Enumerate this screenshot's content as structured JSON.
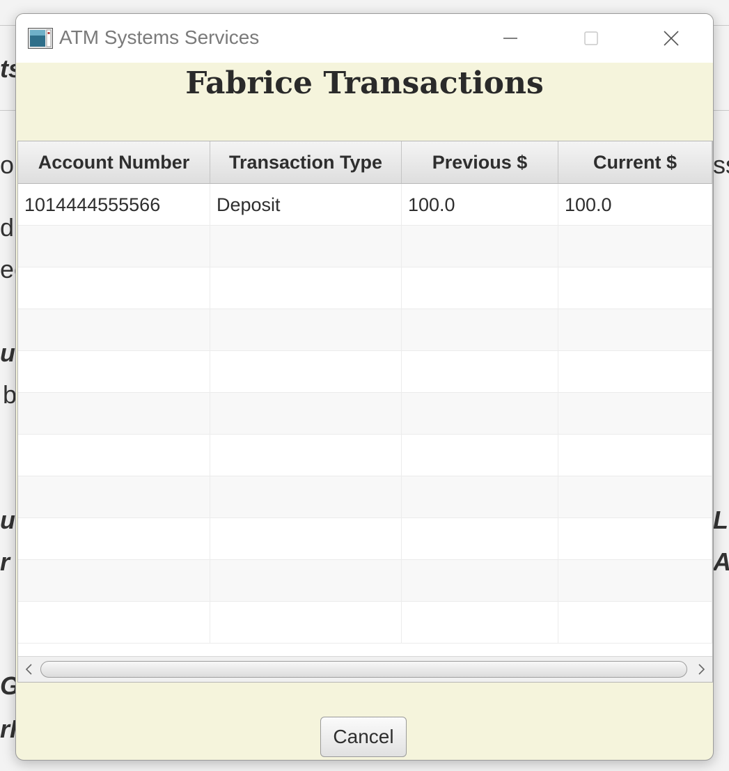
{
  "window": {
    "title": "ATM Systems Services",
    "controls": [
      "minimize",
      "maximize",
      "close"
    ]
  },
  "heading": "Fabrice Transactions",
  "table": {
    "columns": [
      "Account Number",
      "Transaction Type",
      "Previous $",
      "Current $"
    ],
    "rows": [
      [
        "1014444555566",
        "Deposit",
        "100.0",
        "100.0"
      ]
    ],
    "empty_rows": 10
  },
  "buttons": {
    "cancel": "Cancel"
  },
  "background_fragments": [
    "ts",
    "ou",
    "d",
    "ec",
    "ur",
    "b",
    "u",
    "r",
    "Gi",
    "rH",
    "ss",
    "L",
    "As"
  ],
  "colors": {
    "dialog_background": "#f5f4dc",
    "titlebar": "#ffffff",
    "table_header": "#dedede"
  }
}
